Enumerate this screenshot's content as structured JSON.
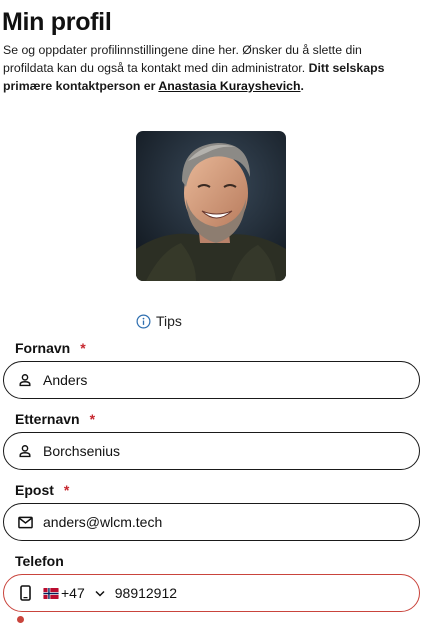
{
  "page": {
    "title": "Min profil",
    "intro_text": "Se og oppdater profilinnstillingene dine her. Ønsker du å slette din profildata kan du også ta kontakt med din administrator. ",
    "intro_bold": "Ditt selskaps primære kontaktperson er ",
    "contact_name": "Anastasia Kurayshevich",
    "intro_end": "."
  },
  "tips": {
    "label": "Tips"
  },
  "form": {
    "first_name": {
      "label": "Fornavn",
      "required_mark": "*",
      "value": "Anders",
      "icon": "person-icon"
    },
    "last_name": {
      "label": "Etternavn",
      "required_mark": "*",
      "value": "Borchsenius",
      "icon": "person-icon"
    },
    "email": {
      "label": "Epost",
      "required_mark": "*",
      "value": "anders@wlcm.tech",
      "icon": "mail-icon"
    },
    "phone": {
      "label": "Telefon",
      "country_code": "+47",
      "country_flag": "norway-flag-icon",
      "value": "98912912",
      "icon": "phone-icon",
      "status": "error"
    }
  },
  "colors": {
    "text": "#111111",
    "required": "#c6262e",
    "error_border": "#c9443c",
    "info_icon": "#2f6fb0"
  }
}
